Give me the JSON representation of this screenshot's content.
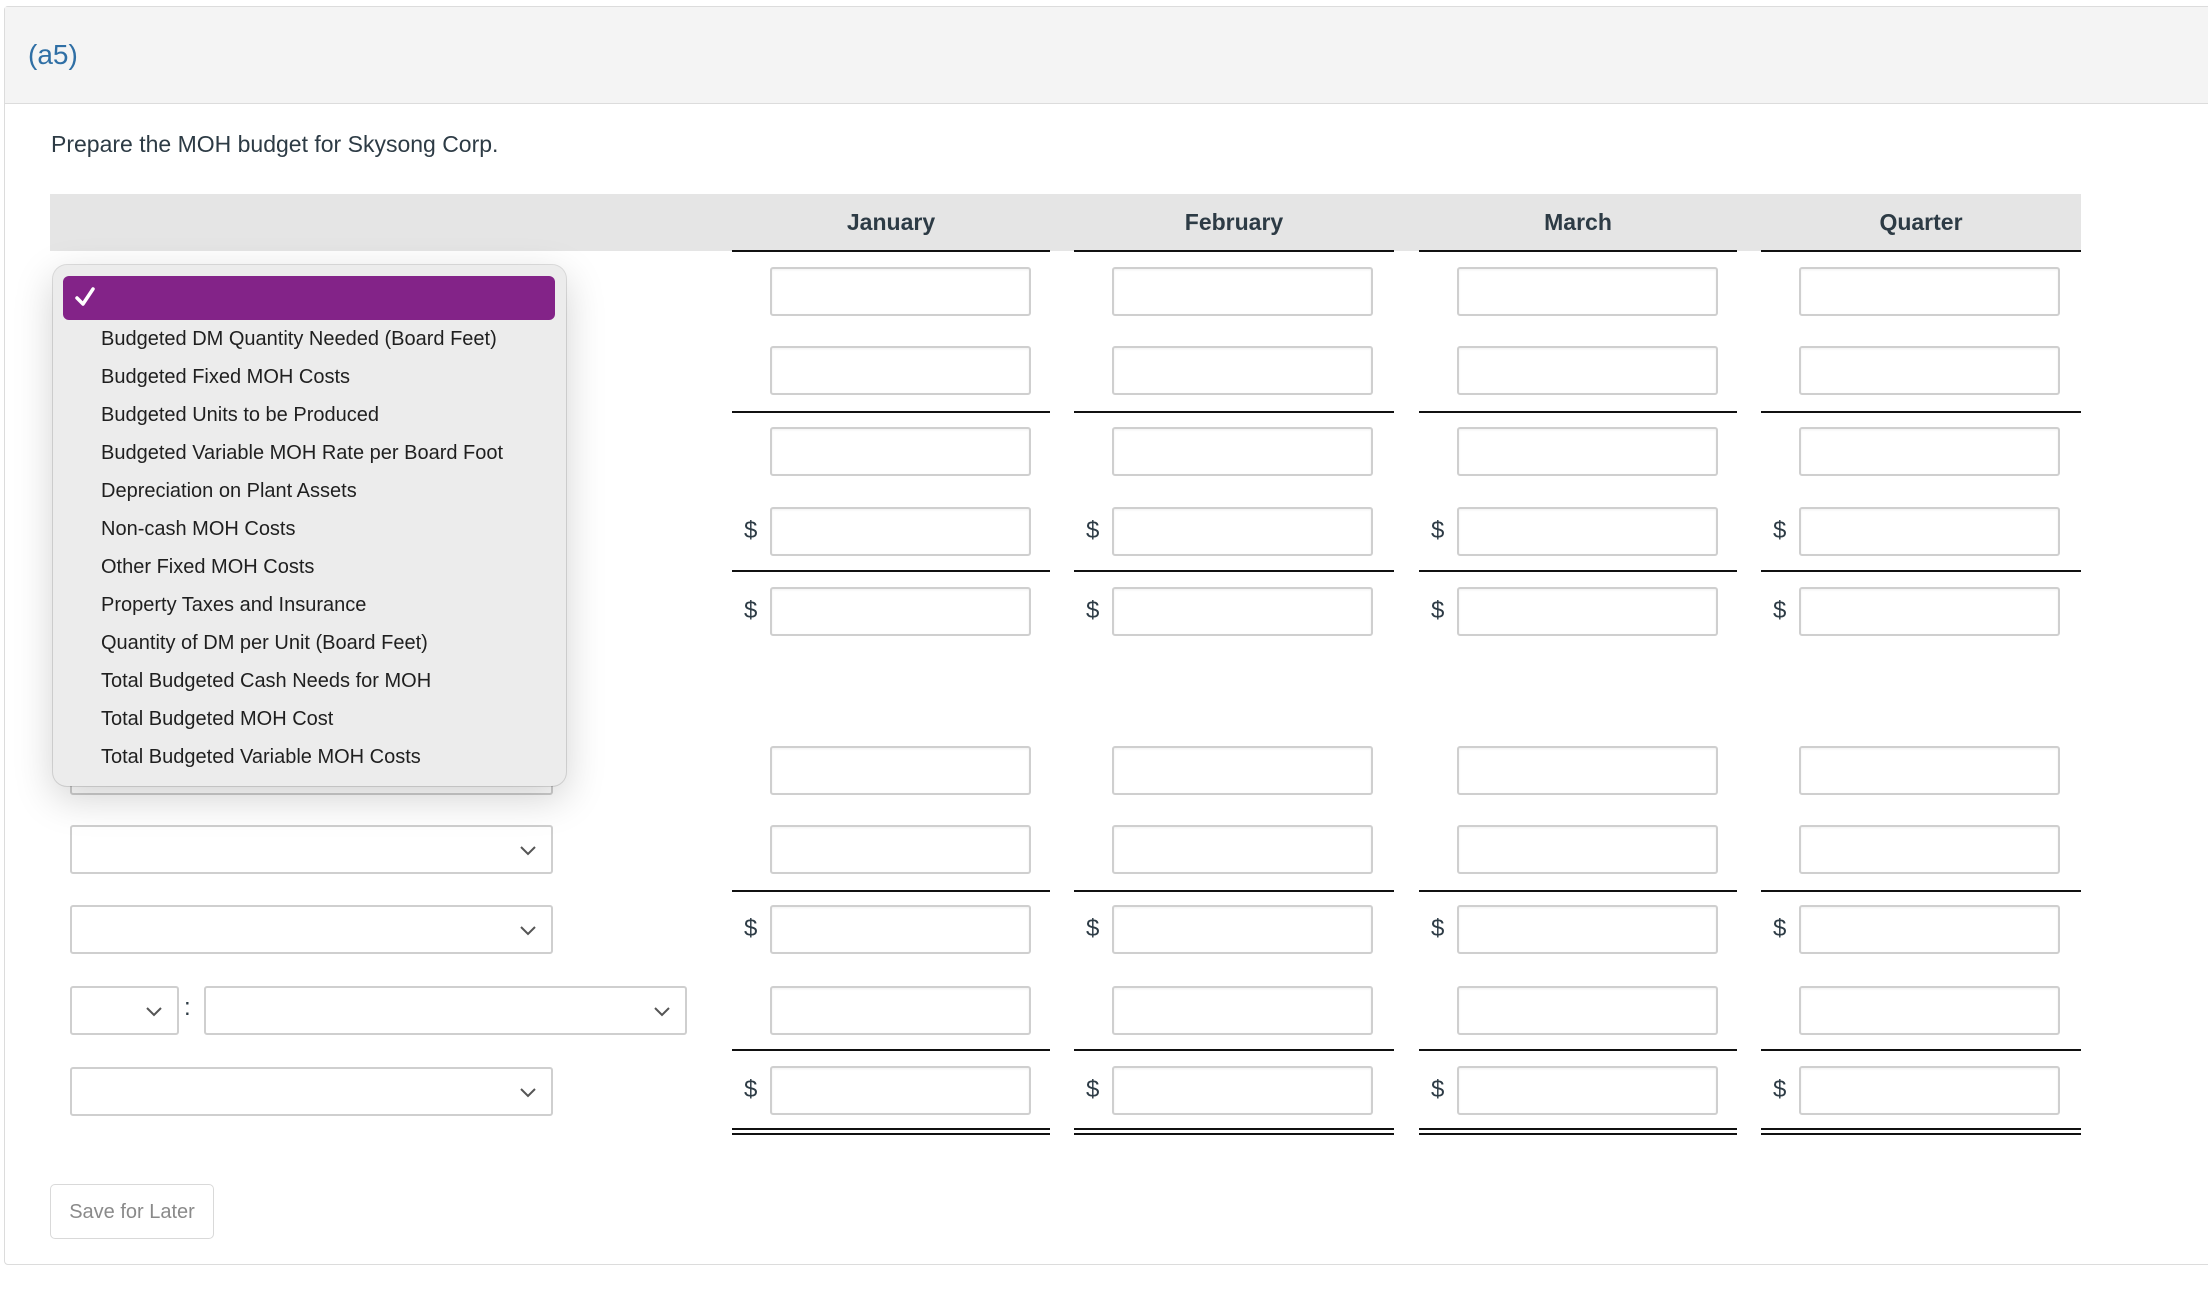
{
  "header": {
    "part_label": "(a5)"
  },
  "prompt": "Prepare the MOH budget for Skysong Corp.",
  "table": {
    "columns": [
      "January",
      "February",
      "March",
      "Quarter"
    ],
    "rows": [
      {
        "label": "",
        "dollar": false,
        "values": [
          "",
          "",
          "",
          ""
        ]
      },
      {
        "label": "",
        "dollar": false,
        "values": [
          "",
          "",
          "",
          ""
        ]
      },
      {
        "label": "",
        "dollar": false,
        "values": [
          "",
          "",
          "",
          ""
        ]
      },
      {
        "label": "",
        "dollar": true,
        "values": [
          "",
          "",
          "",
          ""
        ]
      },
      {
        "label": "",
        "dollar": true,
        "values": [
          "",
          "",
          "",
          ""
        ]
      },
      {
        "label": "",
        "dollar": false,
        "values": [
          "",
          "",
          "",
          ""
        ]
      },
      {
        "label": "",
        "dollar": false,
        "values": [
          "",
          "",
          "",
          ""
        ]
      },
      {
        "label": "",
        "dollar": true,
        "values": [
          "",
          "",
          "",
          ""
        ]
      },
      {
        "label": "",
        "dollar": false,
        "values": [
          "",
          "",
          "",
          ""
        ],
        "prefix_select": "",
        "separator": ":"
      },
      {
        "label": "",
        "dollar": true,
        "values": [
          "",
          "",
          "",
          ""
        ]
      }
    ],
    "currency_symbol": "$"
  },
  "open_dropdown": {
    "selected": "",
    "selected_icon": "check-icon",
    "options": [
      "Budgeted DM Quantity Needed (Board Feet)",
      "Budgeted Fixed MOH Costs",
      "Budgeted Units to be Produced",
      "Budgeted Variable MOH Rate per Board Foot",
      "Depreciation on Plant Assets",
      "Non-cash MOH Costs",
      "Other Fixed MOH Costs",
      "Property Taxes and Insurance",
      "Quantity of DM per Unit (Board Feet)",
      "Total Budgeted Cash Needs for MOH",
      "Total Budgeted MOH Cost",
      "Total Budgeted Variable MOH Costs"
    ]
  },
  "separator_colon": ":",
  "buttons": {
    "save_label": "Save for Later"
  },
  "colors": {
    "accent_purple": "#832388",
    "part_label_blue": "#2f6fa5"
  }
}
